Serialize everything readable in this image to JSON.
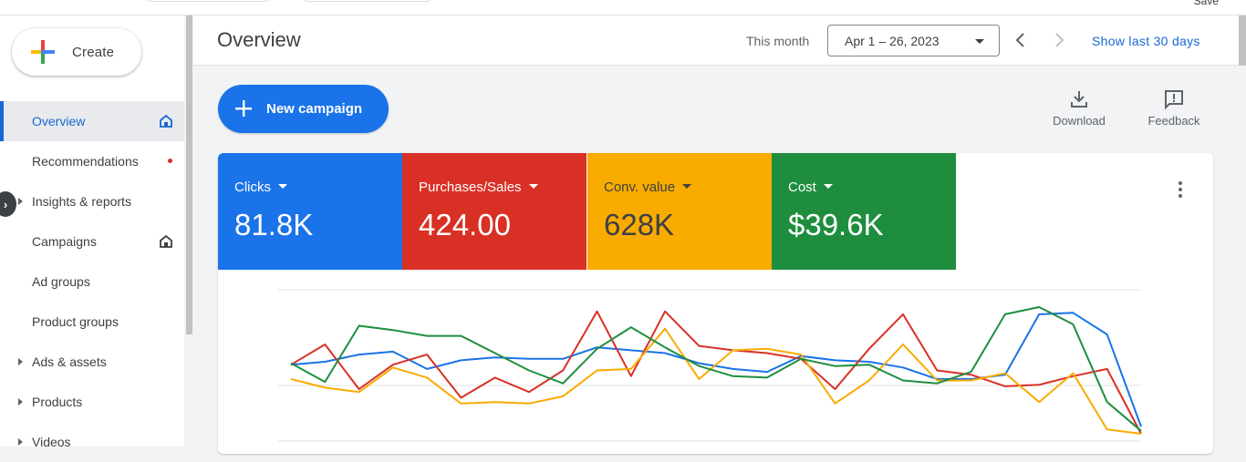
{
  "top": {
    "save_label": "Save"
  },
  "sidebar": {
    "create_label": "Create",
    "items": [
      {
        "label": "Overview",
        "active": true
      },
      {
        "label": "Recommendations"
      },
      {
        "label": "Insights & reports"
      },
      {
        "label": "Campaigns"
      },
      {
        "label": "Ad groups"
      },
      {
        "label": "Product groups"
      },
      {
        "label": "Ads & assets"
      },
      {
        "label": "Products"
      },
      {
        "label": "Videos"
      }
    ]
  },
  "header": {
    "title": "Overview",
    "period_label": "This month",
    "date_range": "Apr 1 – 26, 2023",
    "show_last": "Show last 30 days"
  },
  "actions": {
    "new_campaign": "New campaign",
    "download": "Download",
    "feedback": "Feedback"
  },
  "metrics": [
    {
      "name": "Clicks",
      "value": "81.8K",
      "color": "#1a73e8",
      "text_color": "#ffffff"
    },
    {
      "name": "Purchases/Sales",
      "value": "424.00",
      "color": "#d93025",
      "text_color": "#ffffff"
    },
    {
      "name": "Conv. value",
      "value": "628K",
      "color": "#f9ab00",
      "text_color": "#3c4043"
    },
    {
      "name": "Cost",
      "value": "$39.6K",
      "color": "#1e8e3e",
      "text_color": "#ffffff"
    }
  ],
  "chart_data": {
    "type": "line",
    "title": "",
    "x": [
      1,
      2,
      3,
      4,
      5,
      6,
      7,
      8,
      9,
      10,
      11,
      12,
      13,
      14,
      15,
      16,
      17,
      18,
      19,
      20,
      21,
      22,
      23,
      24,
      25,
      26
    ],
    "ylim": [
      0,
      100
    ],
    "grid": true,
    "series": [
      {
        "color": "#1a73e8",
        "values": [
          48,
          50,
          55,
          57,
          45,
          51,
          53,
          52,
          52,
          60,
          58,
          56,
          49,
          45,
          43,
          54,
          51,
          50,
          46,
          38,
          38,
          41,
          83,
          84,
          69,
          5
        ]
      },
      {
        "color": "#d93025",
        "values": [
          48,
          62,
          31,
          48,
          55,
          25,
          39,
          29,
          44,
          85,
          40,
          85,
          61,
          58,
          56,
          52,
          31,
          59,
          83,
          44,
          41,
          33,
          34,
          40,
          45,
          0
        ]
      },
      {
        "color": "#f9ab00",
        "values": [
          38,
          32,
          29,
          46,
          39,
          21,
          22,
          21,
          26,
          44,
          45,
          73,
          38,
          58,
          59,
          55,
          21,
          37,
          62,
          37,
          37,
          42,
          22,
          42,
          3,
          0
        ]
      },
      {
        "color": "#1e8e3e",
        "values": [
          49,
          36,
          75,
          72,
          68,
          68,
          56,
          44,
          35,
          59,
          74,
          60,
          47,
          40,
          39,
          52,
          47,
          48,
          37,
          35,
          43,
          83,
          88,
          76,
          22,
          2
        ]
      }
    ]
  }
}
